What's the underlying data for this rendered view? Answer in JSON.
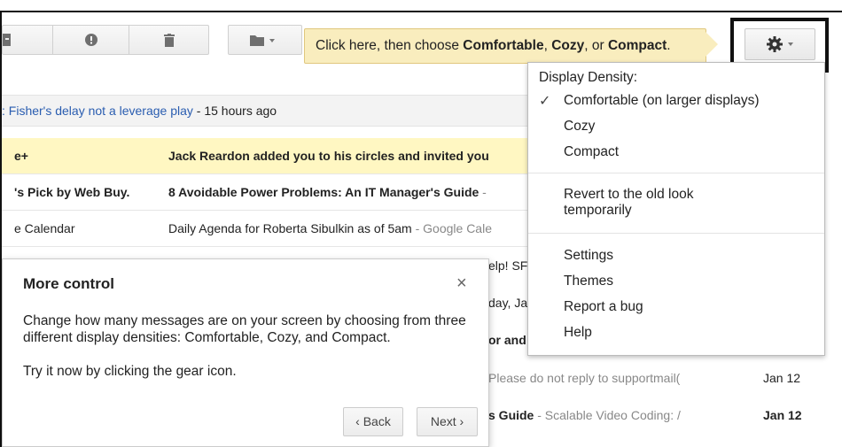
{
  "hint": {
    "text_prefix": "Click here, then choose ",
    "opt1": "Comfortable",
    "sep1": ", ",
    "opt2": "Cozy",
    "sep2": ", or ",
    "opt3": "Compact",
    "suffix": "."
  },
  "info_row": {
    "link": ": Fisher's delay not a leverage play",
    "time": " - 15 hours ago"
  },
  "rows": [
    {
      "from": "e+",
      "subject": "Jack Reardon added you to his circles and invited you",
      "snippet": ""
    },
    {
      "from": "'s Pick by Web Buy.",
      "subject": "8 Avoidable Power Problems: An IT Manager's Guide",
      "snippet": " -"
    },
    {
      "from": "e Calendar",
      "subject": "Daily Agenda for Roberta Sibulkin as of 5am",
      "snippet": " - Google Cale"
    }
  ],
  "partial_rows": [
    {
      "text": "elp! SF",
      "date": ""
    },
    {
      "text": "day, Ja",
      "date": ""
    },
    {
      "text": "or and",
      "date": ""
    },
    {
      "text": "Please do not reply to supportmail(",
      "date": "Jan 12"
    },
    {
      "text": "s Guide",
      "snippet": " - Scalable Video Coding: /",
      "date": "Jan 12"
    }
  ],
  "menu": {
    "header": "Display Density:",
    "check": "✓",
    "comfortable": "Comfortable (on larger displays)",
    "cozy": "Cozy",
    "compact": "Compact",
    "revert_line1": "Revert to the old look",
    "revert_line2": "temporarily",
    "settings": "Settings",
    "themes": "Themes",
    "report": "Report a bug",
    "help": "Help"
  },
  "card": {
    "title": "More control",
    "close": "×",
    "body": "Change how many messages are on your screen by choosing from three different display densities: Comfortable, Cozy, and Compact.",
    "try": "Try it now by clicking the gear icon.",
    "back": "‹ Back",
    "next": "Next ›"
  },
  "colors": {
    "hint_bg": "#f9edbe",
    "highlight_row": "#fff7c2",
    "link": "#2a5db0"
  }
}
